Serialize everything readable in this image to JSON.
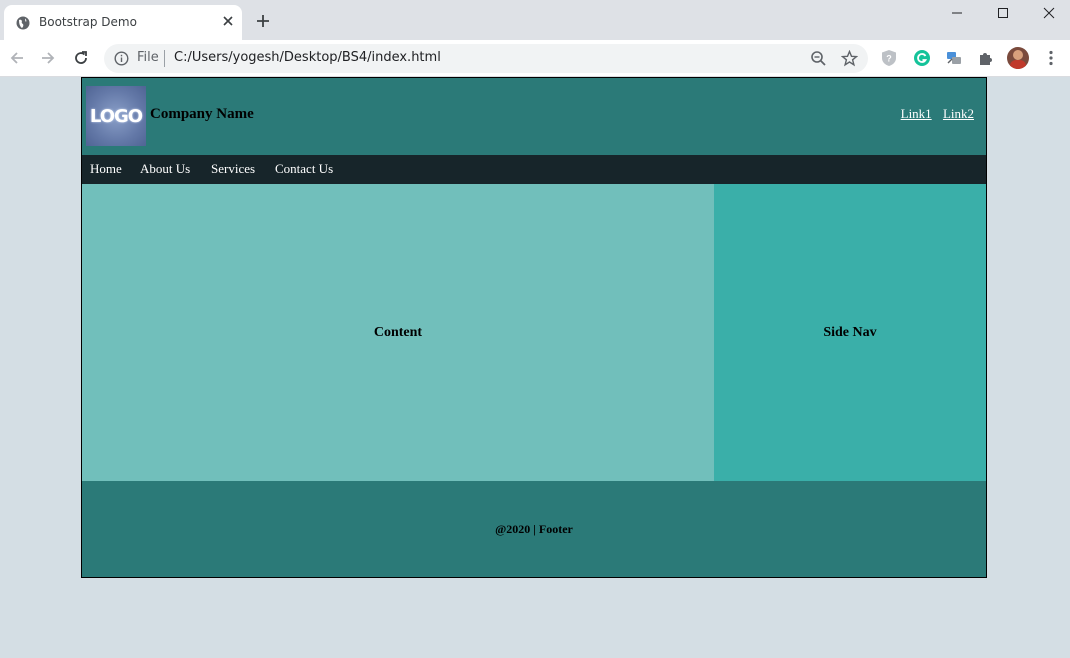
{
  "browser": {
    "tab_title": "Bootstrap Demo",
    "file_label": "File",
    "url": "C:/Users/yogesh/Desktop/BS4/index.html"
  },
  "site": {
    "logo_text": "LOGO",
    "company_name": "Company Name",
    "header_links": [
      "Link1",
      "Link2"
    ],
    "nav_items": [
      "Home",
      "About Us",
      "Services",
      "Contact Us"
    ],
    "content_label": "Content",
    "sidenav_label": "Side Nav",
    "footer_text": "@2020 | Footer"
  },
  "colors": {
    "header_bg": "#2b7a78",
    "nav_bg": "#17252a",
    "content_bg": "#71bfbb",
    "sidenav_bg": "#3aafa9",
    "footer_bg": "#2b7a78",
    "page_bg": "#d4dee4"
  }
}
